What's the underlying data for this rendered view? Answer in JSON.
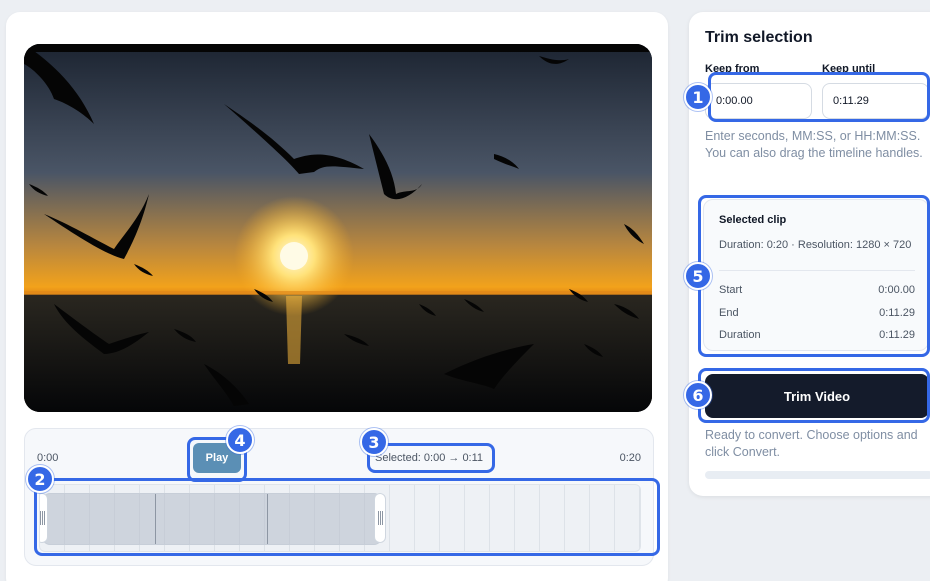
{
  "player": {
    "time_start": "0:00",
    "time_end": "0:20",
    "play_label": "Play",
    "selected_text": "Selected: 0:00 → 0:11"
  },
  "sidebar": {
    "title": "Trim selection",
    "keep_from_label": "Keep from",
    "keep_until_label": "Keep until",
    "keep_from_value": "0:00.00",
    "keep_until_value": "0:11.29",
    "hint": "Enter seconds, MM:SS, or HH:MM:SS. You can also drag the timeline handles.",
    "clip": {
      "title": "Selected clip",
      "info": "Duration: 0:20 · Resolution: 1280 × 720",
      "rows": [
        {
          "label": "Start",
          "value": "0:00.00"
        },
        {
          "label": "End",
          "value": "0:11.29"
        },
        {
          "label": "Duration",
          "value": "0:11.29"
        }
      ]
    },
    "trim_button": "Trim Video",
    "status": "Ready to convert. Choose options and click Convert.",
    "progress": 0
  },
  "annotations": [
    "1",
    "2",
    "3",
    "4",
    "5",
    "6"
  ],
  "colors": {
    "accent": "#3568e6",
    "play_button": "#5b8fb5",
    "trim_button": "#141b2b",
    "hint_text": "#7f8ea3"
  }
}
